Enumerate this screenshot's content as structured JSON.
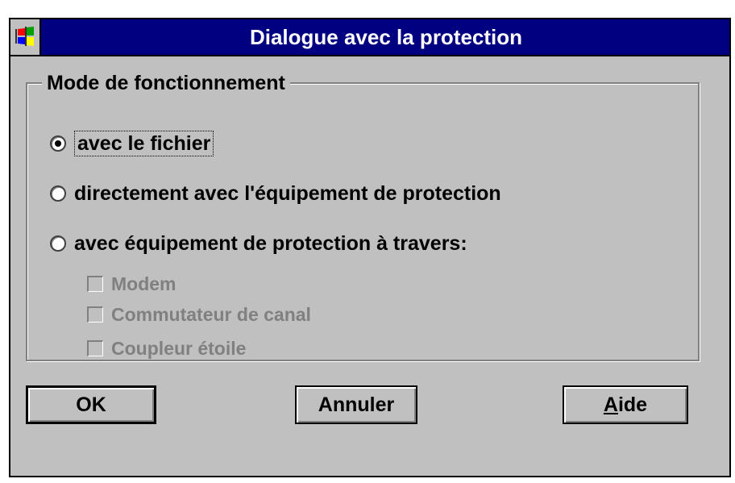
{
  "window": {
    "title": "Dialogue avec la protection",
    "system_menu_icon": "windows-logo-icon"
  },
  "group": {
    "label": "Mode de fonctionnement",
    "radios": [
      {
        "label": "avec le fichier",
        "checked": true
      },
      {
        "label": "directement avec l'équipement de protection",
        "checked": false
      },
      {
        "label": "avec équipement de protection à travers:",
        "checked": false
      }
    ],
    "checkboxes": [
      {
        "label": "Modem",
        "checked": false,
        "enabled": false
      },
      {
        "label": "Commutateur de canal",
        "checked": false,
        "enabled": false
      },
      {
        "label": "Coupleur étoile",
        "checked": false,
        "enabled": false
      }
    ]
  },
  "buttons": {
    "ok_label": "OK",
    "cancel_label": "Annuler",
    "help_mnemonic": "A",
    "help_rest": "ide"
  },
  "colors": {
    "titlebar": "#000080",
    "face": "#c0c0c0",
    "disabled_text": "#808080"
  }
}
